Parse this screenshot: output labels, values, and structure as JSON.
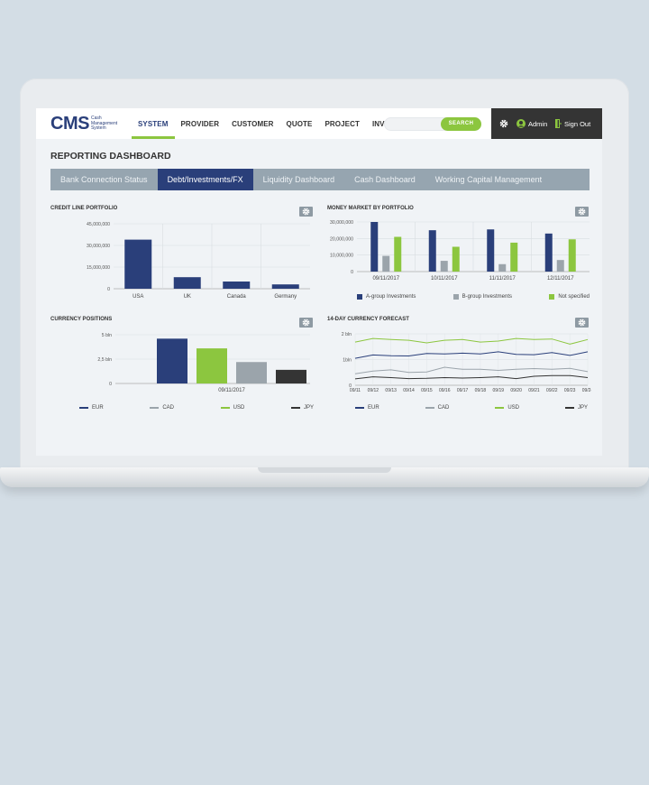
{
  "colors": {
    "navy": "#2a3f7a",
    "green": "#8cc63f",
    "gray": "#9ba4ab",
    "dark": "#343434"
  },
  "header": {
    "logo": "CMS",
    "logo_sub": [
      "Cash",
      "Management",
      "System"
    ],
    "nav": [
      {
        "label": "SYSTEM",
        "active": true
      },
      {
        "label": "PROVIDER"
      },
      {
        "label": "CUSTOMER"
      },
      {
        "label": "QUOTE"
      },
      {
        "label": "PROJECT"
      },
      {
        "label": "INVOICING"
      }
    ],
    "search": {
      "placeholder": "",
      "button": "SEARCH"
    },
    "user": "Admin",
    "signout": "Sign Out",
    "icons": [
      "gear-icon",
      "user-icon",
      "sign-out-icon"
    ]
  },
  "page_title": "REPORTING DASHBOARD",
  "tabs": [
    {
      "label": "Bank Connection Status"
    },
    {
      "label": "Debt/Investments/FX",
      "active": true
    },
    {
      "label": "Liquidity Dashboard"
    },
    {
      "label": "Cash Dashboard"
    },
    {
      "label": "Working Capital Management"
    }
  ],
  "panels": {
    "credit": "CREDIT LINE PORTFOLIO",
    "money": "MONEY MARKET BY PORTFOLIO",
    "currency": "CURRENCY POSITIONS",
    "forecast": "14-DAY CURRENCY FORECAST"
  },
  "chart_data": [
    {
      "id": "credit",
      "type": "bar",
      "title": "CREDIT LINE PORTFOLIO",
      "categories": [
        "USA",
        "UK",
        "Canada",
        "Germany"
      ],
      "values": [
        34000000,
        8000000,
        5000000,
        3000000
      ],
      "ylim": [
        0,
        45000000
      ],
      "yticks": [
        0,
        15000000,
        30000000,
        45000000
      ],
      "ytick_labels": [
        "0",
        "15,000,000",
        "30,000,000",
        "45,000,000"
      ],
      "color": "#2a3f7a",
      "grid": true
    },
    {
      "id": "money",
      "type": "bar",
      "title": "MONEY MARKET BY PORTFOLIO",
      "categories": [
        "09/11/2017",
        "10/11/2017",
        "11/11/2017",
        "12/11/2017"
      ],
      "series": [
        {
          "name": "A-group Investments",
          "values": [
            30000000,
            25000000,
            25500000,
            23000000
          ],
          "color": "#2a3f7a"
        },
        {
          "name": "B-group Investments",
          "values": [
            9500000,
            6500000,
            4500000,
            7000000
          ],
          "color": "#9ba4ab"
        },
        {
          "name": "Not specified",
          "values": [
            21000000,
            15000000,
            17500000,
            19500000
          ],
          "color": "#8cc63f"
        }
      ],
      "ylim": [
        0,
        30000000
      ],
      "yticks": [
        0,
        10000000,
        20000000,
        30000000
      ],
      "ytick_labels": [
        "0",
        "10,000,000",
        "20,000,000",
        "30,000,000"
      ],
      "legend": "bottom",
      "grid": true
    },
    {
      "id": "currency",
      "type": "bar",
      "title": "CURRENCY POSITIONS",
      "categories": [
        "09/11/2017"
      ],
      "series": [
        {
          "name": "EUR",
          "values": [
            4.6
          ],
          "color": "#2a3f7a"
        },
        {
          "name": "CAD",
          "values": [
            3.6
          ],
          "color": "#9ba4ab"
        },
        {
          "name": "USD",
          "values": [
            2.2
          ],
          "color": "#8cc63f"
        },
        {
          "name": "JPY",
          "values": [
            1.4
          ],
          "color": "#343434"
        }
      ],
      "bar_colors": [
        "#2a3f7a",
        "#8cc63f",
        "#9ba4ab",
        "#343434"
      ],
      "ylim": [
        0,
        5
      ],
      "yticks": [
        0,
        2.5,
        5
      ],
      "ytick_labels": [
        "0",
        "2,5 bln",
        "5 bln"
      ],
      "legend": "bottom"
    },
    {
      "id": "forecast",
      "type": "line",
      "title": "14-DAY CURRENCY FORECAST",
      "x": [
        "09/11",
        "09/12",
        "09/13",
        "09/14",
        "09/15",
        "09/16",
        "09/17",
        "09/18",
        "09/19",
        "09/20",
        "09/21",
        "09/22",
        "09/23",
        "09/24"
      ],
      "series": [
        {
          "name": "EUR",
          "color": "#2a3f7a",
          "values": [
            1.05,
            1.18,
            1.15,
            1.14,
            1.24,
            1.22,
            1.25,
            1.22,
            1.3,
            1.2,
            1.19,
            1.27,
            1.16,
            1.3
          ]
        },
        {
          "name": "CAD",
          "color": "#9ba4ab",
          "values": [
            0.45,
            0.55,
            0.6,
            0.5,
            0.52,
            0.7,
            0.62,
            0.62,
            0.58,
            0.62,
            0.65,
            0.62,
            0.66,
            0.53
          ]
        },
        {
          "name": "USD",
          "color": "#8cc63f",
          "values": [
            1.68,
            1.82,
            1.78,
            1.75,
            1.65,
            1.75,
            1.78,
            1.68,
            1.72,
            1.82,
            1.78,
            1.8,
            1.6,
            1.78
          ]
        },
        {
          "name": "JPY",
          "color": "#343434",
          "values": [
            0.25,
            0.33,
            0.3,
            0.26,
            0.27,
            0.3,
            0.28,
            0.3,
            0.33,
            0.26,
            0.35,
            0.38,
            0.38,
            0.3
          ]
        }
      ],
      "ylim": [
        0,
        2
      ],
      "yticks": [
        0,
        1,
        2
      ],
      "ytick_labels": [
        "0",
        "1bln",
        "2 bln"
      ],
      "legend": "bottom",
      "grid": true
    }
  ]
}
